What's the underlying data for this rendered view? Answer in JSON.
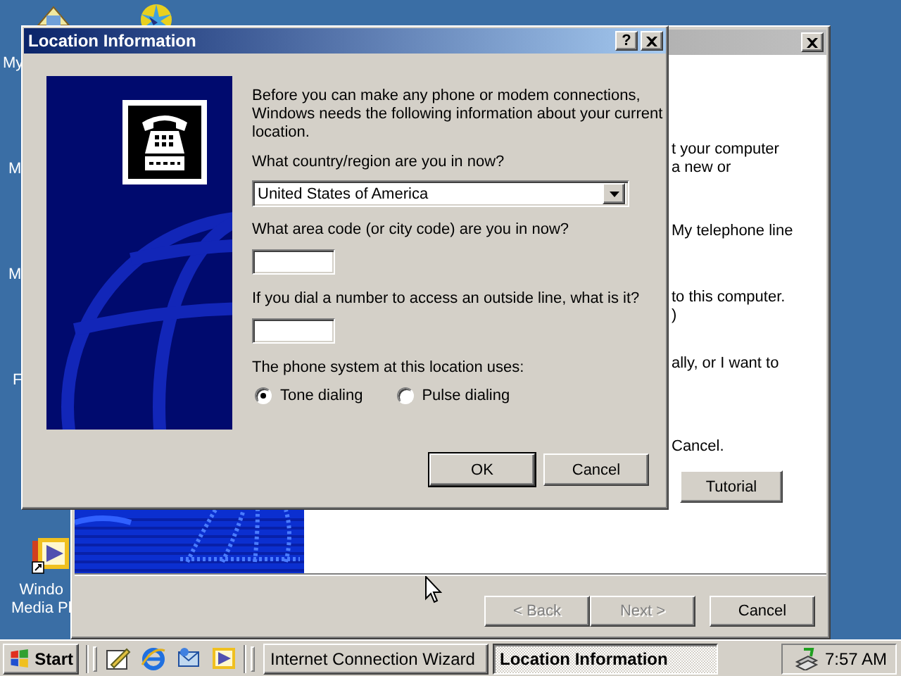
{
  "desktop": {
    "icons": [
      {
        "kind": "cut",
        "lines": [
          "My"
        ]
      },
      {
        "kind": "cut",
        "lines": [
          "M"
        ]
      },
      {
        "kind": "cut",
        "lines": [
          "M"
        ]
      },
      {
        "kind": "cut",
        "lines": [
          "F"
        ]
      },
      {
        "kind": "media",
        "lines": [
          "Windo",
          "Media Pl"
        ]
      }
    ]
  },
  "wizard": {
    "active": false,
    "paragraphs": [
      [
        "t your computer",
        "a new or"
      ],
      [
        "My telephone line"
      ],
      [
        "to this computer.",
        ")"
      ],
      [
        "ally, or I want to"
      ],
      [
        "Cancel."
      ]
    ],
    "tutorial_button": "Tutorial",
    "buttons": [
      {
        "label": "< Back",
        "disabled": true
      },
      {
        "label": "Next >",
        "disabled": true
      },
      {
        "label": "Cancel",
        "disabled": false
      }
    ]
  },
  "dialog": {
    "title": "Location Information",
    "help_button": "?",
    "intro": [
      "Before you can make any phone or modem connections,",
      "Windows needs the following information about your current",
      "location."
    ],
    "country_label": "What country/region are you in now?",
    "country": {
      "value": "United States of America"
    },
    "area_code_label": "What area code (or city code) are you in now?",
    "outside_line_label": "If you dial a number to access an outside line, what is it?",
    "phone_system_label": "The phone system at this location uses:",
    "dialing": [
      {
        "label": "Tone dialing",
        "selected": true
      },
      {
        "label": "Pulse dialing",
        "selected": false
      }
    ],
    "buttons": [
      {
        "label": "OK",
        "default": true
      },
      {
        "label": "Cancel",
        "default": false
      }
    ]
  },
  "taskbar": {
    "start": "Start",
    "tasks": [
      {
        "label": "Internet Connection Wizard",
        "selected": false
      },
      {
        "label": "Location Information",
        "selected": true
      }
    ],
    "clock": "7:57 AM"
  }
}
